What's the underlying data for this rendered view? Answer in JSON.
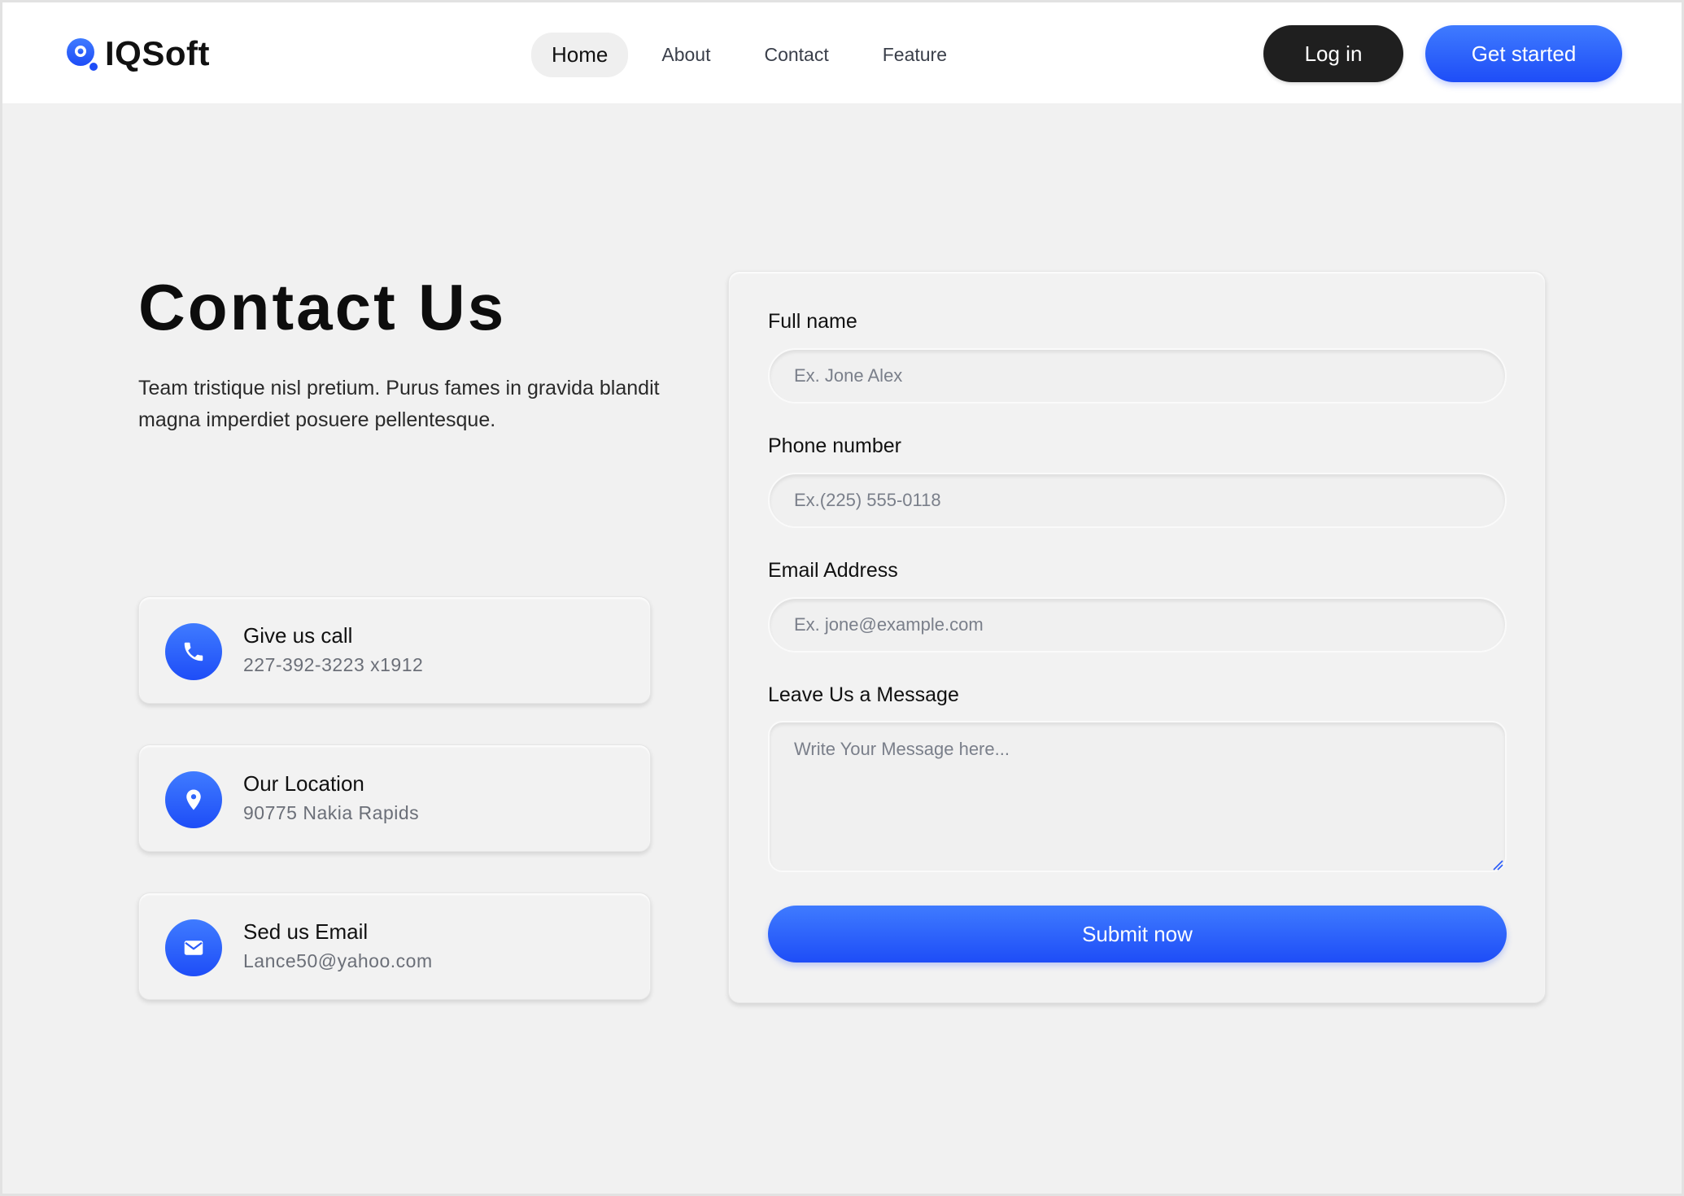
{
  "brand": {
    "name": "IQSoft",
    "accent": "#1e4df7"
  },
  "nav": {
    "items": [
      {
        "label": "Home",
        "active": true
      },
      {
        "label": "About",
        "active": false
      },
      {
        "label": "Contact",
        "active": false
      },
      {
        "label": "Feature",
        "active": false
      }
    ]
  },
  "header": {
    "login_label": "Log in",
    "cta_label": "Get started"
  },
  "hero": {
    "title": "Contact Us",
    "lead": "Team tristique nisl pretium. Purus fames in gravida blandit magna imperdiet posuere pellentesque."
  },
  "contact_cards": [
    {
      "icon": "phone-icon",
      "title": "Give us call",
      "value": "227-392-3223 x1912"
    },
    {
      "icon": "location-pin-icon",
      "title": "Our Location",
      "value": "90775 Nakia Rapids"
    },
    {
      "icon": "mail-icon",
      "title": "Sed us Email",
      "value": "Lance50@yahoo.com"
    }
  ],
  "form": {
    "full_name": {
      "label": "Full name",
      "placeholder": "Ex. Jone Alex"
    },
    "phone": {
      "label": "Phone number",
      "placeholder": "Ex.(225) 555-0118"
    },
    "email": {
      "label": "Email Address",
      "placeholder": "Ex. jone@example.com"
    },
    "message": {
      "label": "Leave Us a Message",
      "placeholder": "Write Your Message here..."
    },
    "submit_label": "Submit now"
  }
}
